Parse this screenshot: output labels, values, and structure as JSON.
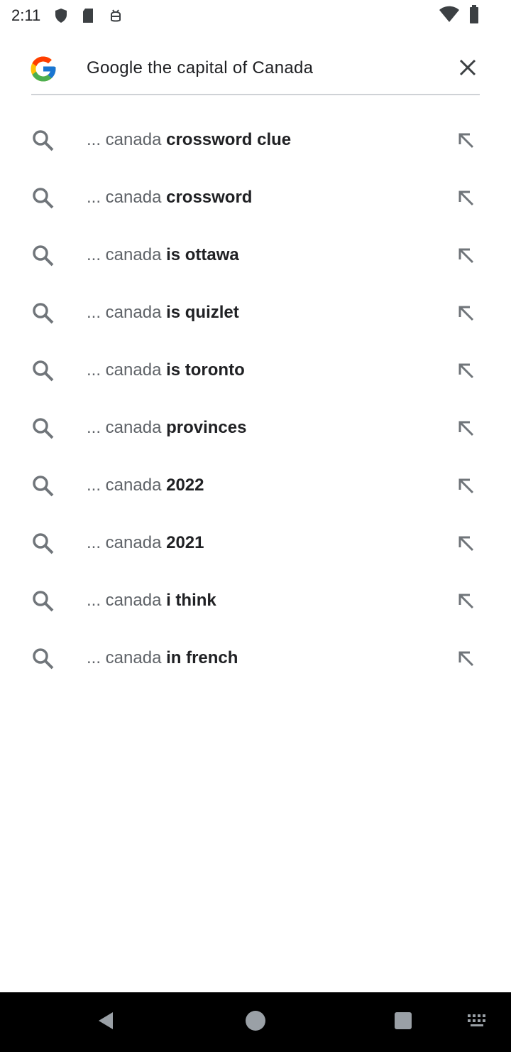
{
  "status_bar": {
    "time": "2:11",
    "icons": [
      "shield-icon",
      "sd-card-icon",
      "android-debug-icon",
      "wifi-icon",
      "battery-icon"
    ]
  },
  "search": {
    "query": "Google the capital of Canada",
    "logo": "google-g-icon",
    "clear_icon": "close-icon"
  },
  "suggestions": [
    {
      "prefix": "... canada",
      "suffix": " crossword clue"
    },
    {
      "prefix": "... canada",
      "suffix": " crossword"
    },
    {
      "prefix": "... canada",
      "suffix": " is ottawa"
    },
    {
      "prefix": "... canada",
      "suffix": " is quizlet"
    },
    {
      "prefix": "... canada",
      "suffix": " is toronto"
    },
    {
      "prefix": "... canada",
      "suffix": " provinces"
    },
    {
      "prefix": "... canada",
      "suffix": " 2022"
    },
    {
      "prefix": "... canada",
      "suffix": " 2021"
    },
    {
      "prefix": "... canada",
      "suffix": " i think"
    },
    {
      "prefix": "... canada",
      "suffix": " in french"
    }
  ],
  "nav_bar": {
    "icons": [
      "back-icon",
      "home-icon",
      "recents-icon",
      "keyboard-icon"
    ]
  },
  "colors": {
    "accent_text": "#202124",
    "muted_text": "#5f6368",
    "icon_gray": "#70757a"
  }
}
